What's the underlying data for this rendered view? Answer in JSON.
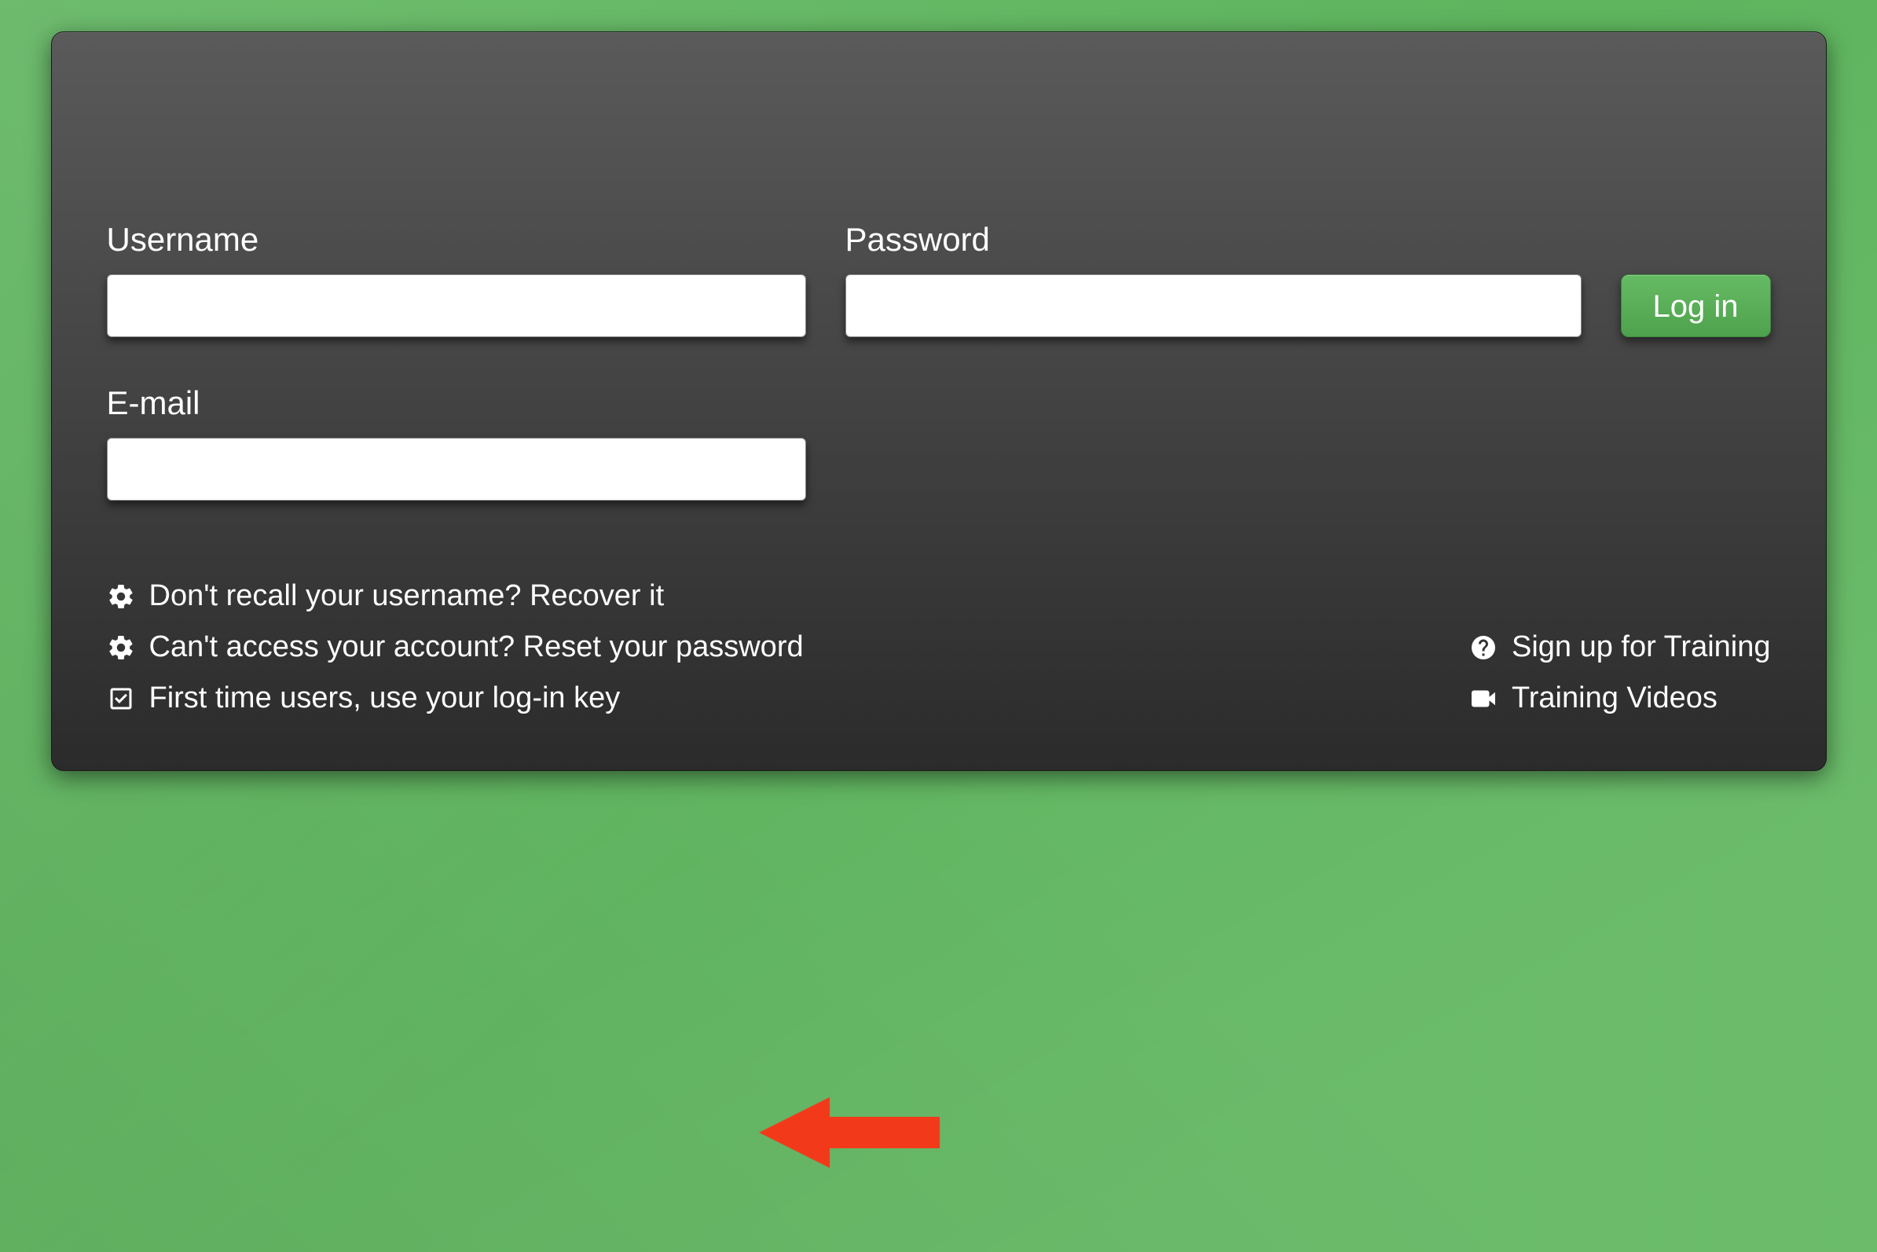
{
  "form": {
    "username_label": "Username",
    "username_value": "",
    "password_label": "Password",
    "password_value": "",
    "email_label": "E-mail",
    "email_value": "",
    "login_button_label": "Log in"
  },
  "left_links": [
    {
      "icon": "gear-icon",
      "text": "Don't recall your username? Recover it"
    },
    {
      "icon": "gear-icon",
      "text": "Can't access your account? Reset your password"
    },
    {
      "icon": "check-square-icon",
      "text": "First time users, use your log-in key"
    }
  ],
  "right_links": [
    {
      "icon": "question-circle-icon",
      "text": "Sign up for Training"
    },
    {
      "icon": "video-camera-icon",
      "text": "Training Videos"
    }
  ],
  "annotation": {
    "type": "arrow",
    "color": "#f23a1a"
  }
}
